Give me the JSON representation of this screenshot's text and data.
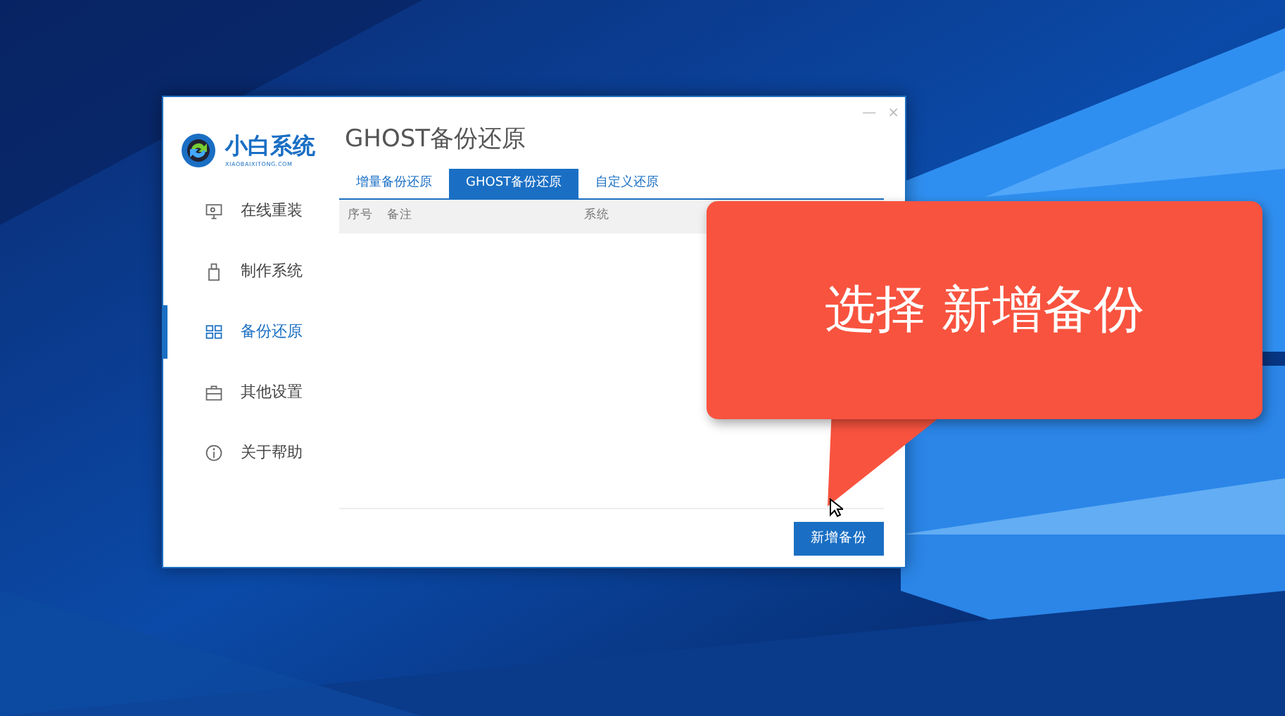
{
  "logo": {
    "title": "小白系统",
    "subtitle": "XIAOBAIXITONG.COM"
  },
  "window_controls": [
    "—",
    "×"
  ],
  "sidebar": {
    "items": [
      {
        "label": "在线重装",
        "selected": false
      },
      {
        "label": "制作系统",
        "selected": false
      },
      {
        "label": "备份还原",
        "selected": true
      },
      {
        "label": "其他设置",
        "selected": false
      },
      {
        "label": "关于帮助",
        "selected": false
      }
    ]
  },
  "page_title": "GHOST备份还原",
  "tabs": [
    {
      "label": "增量备份还原",
      "selected": false
    },
    {
      "label": "GHOST备份还原",
      "selected": true
    },
    {
      "label": "自定义还原",
      "selected": false
    }
  ],
  "table": {
    "columns": [
      "序号",
      "备注",
      "系统"
    ]
  },
  "new_backup_button": "新增备份",
  "callout": {
    "text": "选择 新增备份"
  }
}
